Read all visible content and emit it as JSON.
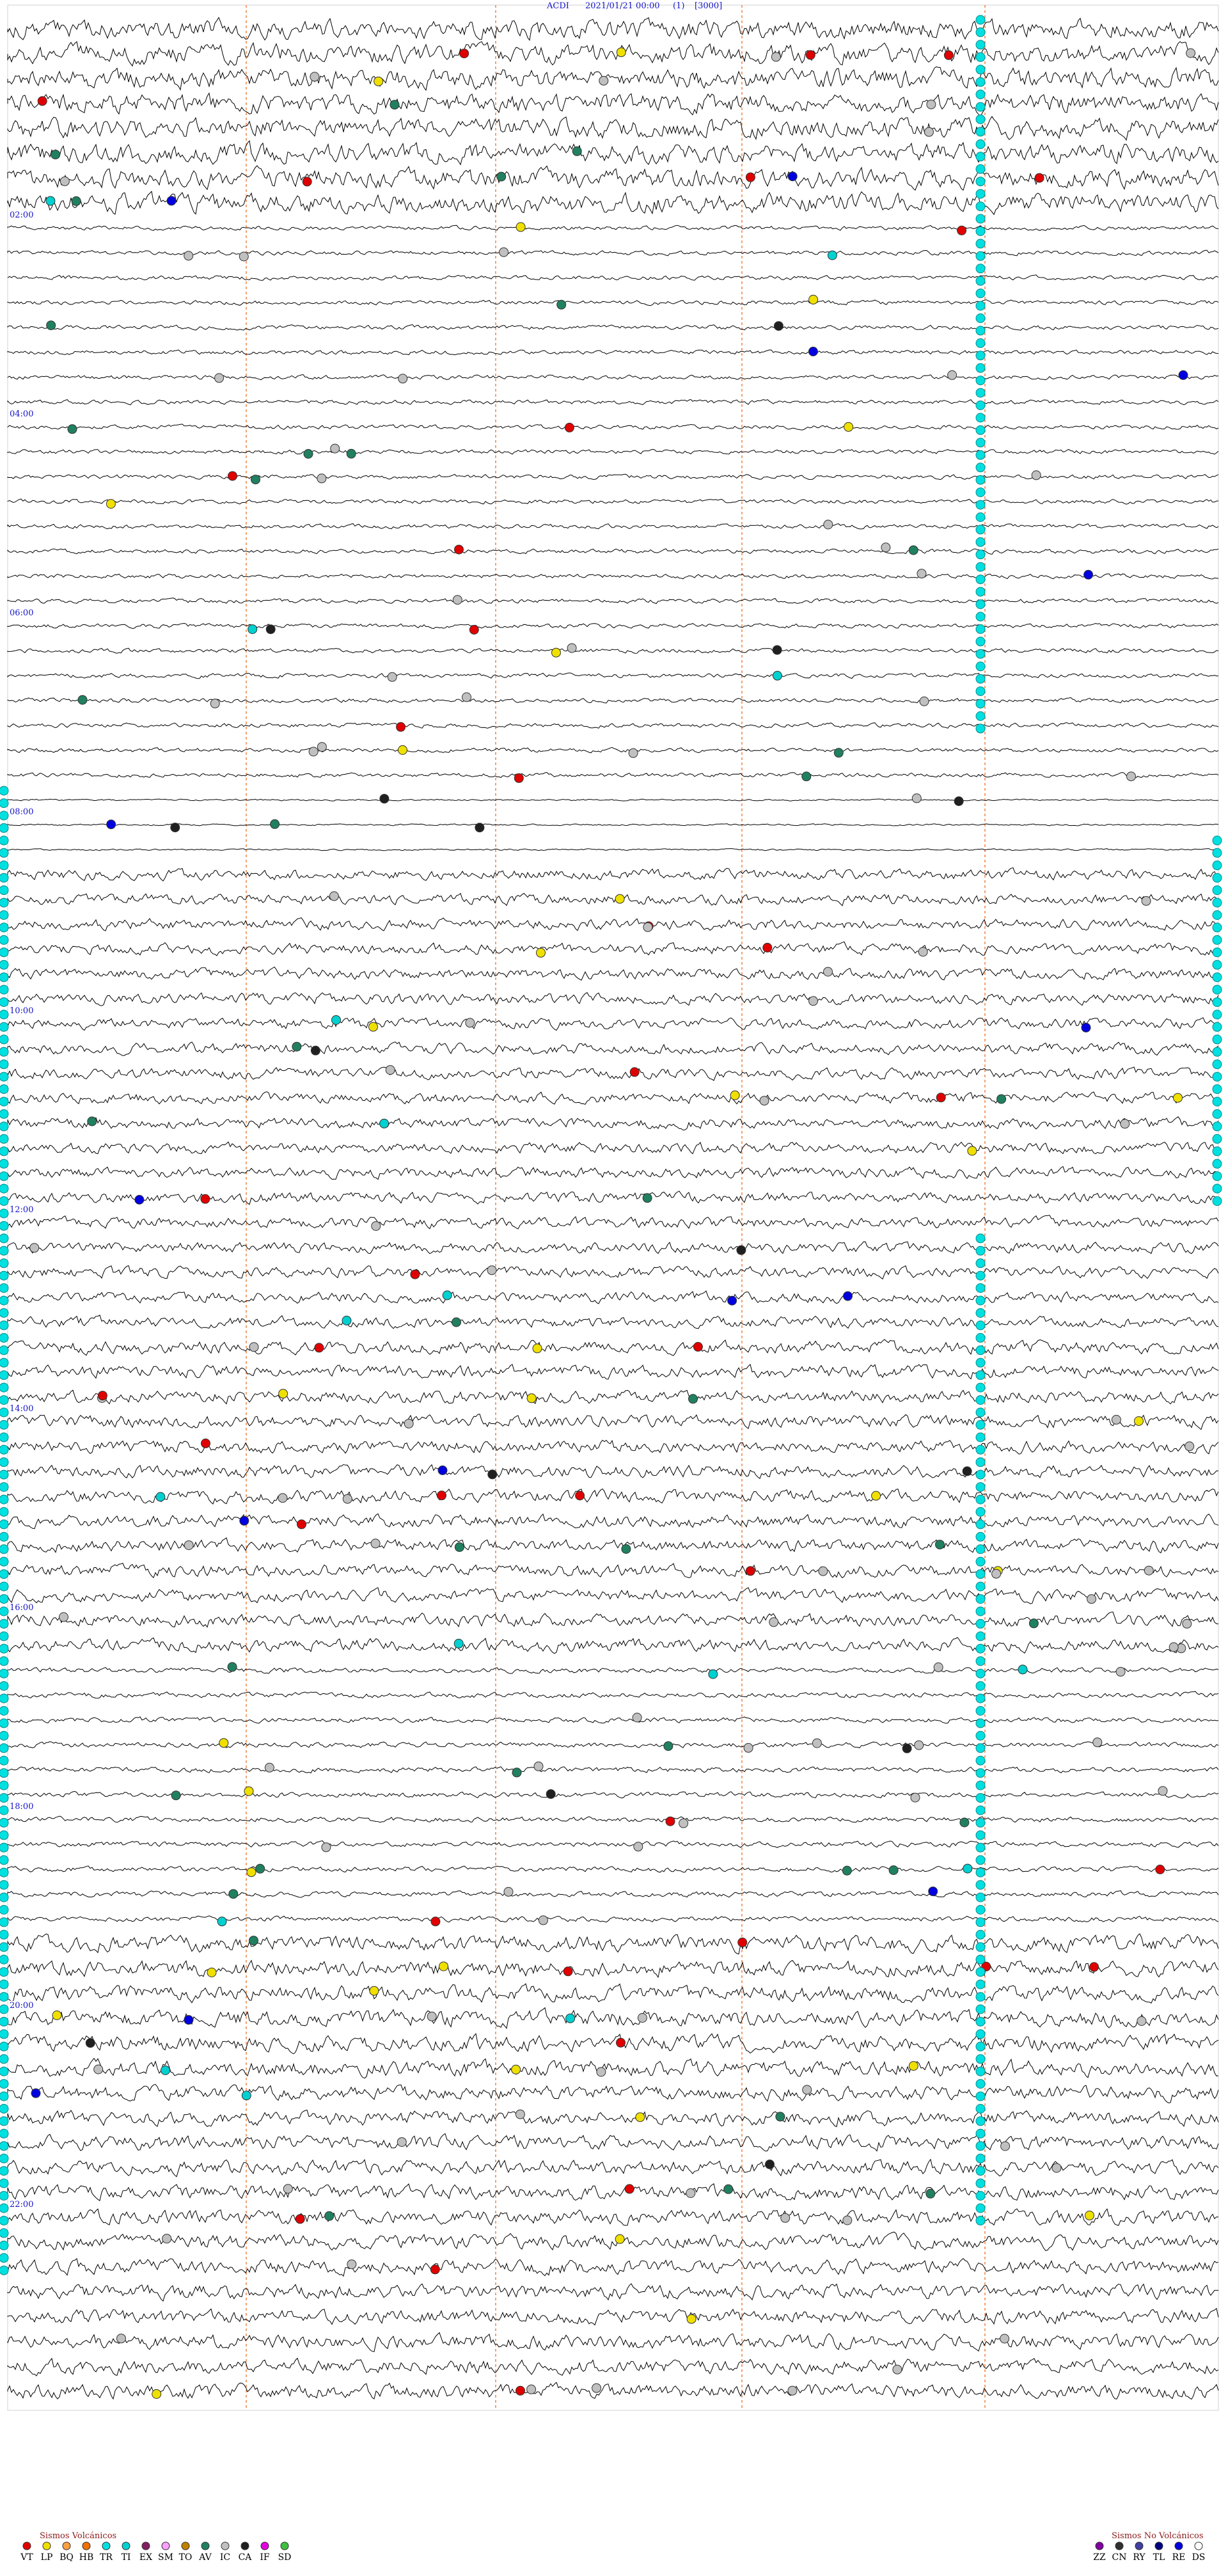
{
  "header": {
    "station": "ACDI",
    "datetime": "2021/01/21 00:00",
    "channel": "(1)",
    "scale": "[3000]"
  },
  "chart_data": {
    "type": "helicorder",
    "start_time": "2021/01/21 00:00",
    "hour_labels": [
      "02:00",
      "04:00",
      "06:00",
      "08:00",
      "10:00",
      "12:00",
      "14:00",
      "16:00",
      "18:00",
      "20:00",
      "22:00"
    ],
    "trace_count": 96,
    "marker_colors": {
      "VT": "#e00000",
      "LP": "#f0e000",
      "BQ": "#ffa040",
      "HB": "#f07000",
      "TR": "#00e0e0",
      "TI": "#00d0d0",
      "EX": "#802060",
      "SM": "#ffa0ff",
      "TO": "#c08000",
      "AV": "#208060",
      "IC": "#c0c0c0",
      "CA": "#202020",
      "IF": "#e000e0",
      "SD": "#40c040",
      "ZZ": "#8000a0",
      "CN": "#303030",
      "RY": "#4040a0",
      "TL": "#000080",
      "RE": "#0000e0",
      "DS": "#ffffff"
    }
  },
  "legend": {
    "volcanic_title": "Sismos Volcánicos",
    "volcanic_codes": [
      "VT",
      "LP",
      "BQ",
      "HB",
      "TR",
      "TI",
      "EX",
      "SM",
      "TO",
      "AV",
      "IC",
      "CA",
      "IF",
      "SD"
    ],
    "nonvolcanic_title": "Sismos No Volcánicos",
    "nonvolcanic_codes": [
      "ZZ",
      "CN",
      "RY",
      "TL",
      "RE",
      "DS"
    ]
  }
}
